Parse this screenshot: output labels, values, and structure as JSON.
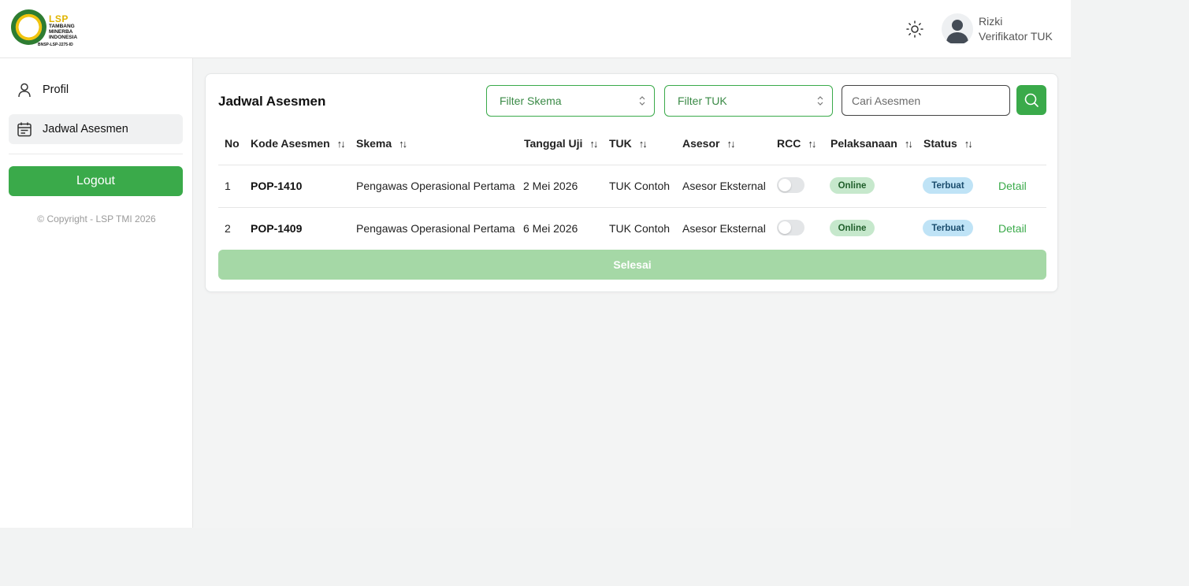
{
  "brand": {
    "logo_title": "LSP",
    "logo_subtitle": "TAMBANG MINERBA INDONESIA",
    "logo_code": "BNSP-LSP-2275-ID",
    "accent_color": "#3aaa4a"
  },
  "header": {
    "theme_icon": "sun-icon",
    "user_name": "Rizki",
    "user_role": "Verifikator TUK"
  },
  "sidebar": {
    "items": [
      {
        "label": "Profil",
        "icon": "user-icon",
        "active": false
      },
      {
        "label": "Jadwal Asesmen",
        "icon": "calendar-icon",
        "active": true
      }
    ],
    "logout_label": "Logout",
    "copyright": "© Copyright - LSP TMI 2026"
  },
  "main": {
    "title": "Jadwal Asesmen",
    "filter_skema": "Filter Skema",
    "filter_tuk": "Filter TUK",
    "search_placeholder": "Cari Asesmen",
    "columns": [
      "No",
      "Kode Asesmen",
      "Skema",
      "Tanggal Uji",
      "TUK",
      "Asesor",
      "RCC",
      "Pelaksanaan",
      "Status"
    ],
    "rows": [
      {
        "no": "1",
        "kode": "POP-1410",
        "skema": "Pengawas Operasional Pertama",
        "tanggal": "2 Mei 2026",
        "tuk": "TUK Contoh",
        "asesor": "Asesor Eksternal",
        "rcc": false,
        "pelaksanaan": "Online",
        "status": "Terbuat",
        "action": "Detail"
      },
      {
        "no": "2",
        "kode": "POP-1409",
        "skema": "Pengawas Operasional Pertama",
        "tanggal": "6 Mei 2026",
        "tuk": "TUK Contoh",
        "asesor": "Asesor Eksternal",
        "rcc": false,
        "pelaksanaan": "Online",
        "status": "Terbuat",
        "action": "Detail"
      }
    ],
    "done_label": "Selesai"
  }
}
